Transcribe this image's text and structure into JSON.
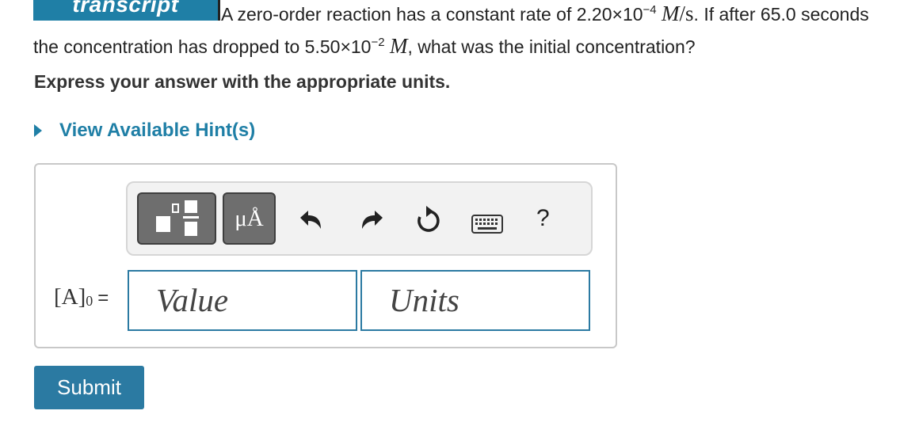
{
  "header": {
    "logo_text": "transcript"
  },
  "question": {
    "text_1": "A zero-order reaction has a constant rate of 2.20×10",
    "exp_1": "−4",
    "unit_1": "M",
    "unit_1b": "/s",
    "text_2": ". If after 65.0 seconds the concentration has dropped to 5.50×10",
    "exp_2": "−2",
    "unit_2": "M",
    "text_3": ", what was the initial concentration?"
  },
  "instructions": "Express your answer with the appropriate units.",
  "hint": {
    "label": "View Available Hint(s)"
  },
  "toolbar": {
    "units_button_label": "μÅ",
    "help_label": "?",
    "icons": [
      "templates-icon",
      "units-icon",
      "undo-icon",
      "redo-icon",
      "reset-icon",
      "keyboard-icon",
      "help-icon"
    ]
  },
  "answer": {
    "variable": "[A]",
    "subscript": "0",
    "equals": "=",
    "value_placeholder": "Value",
    "units_placeholder": "Units"
  },
  "submit_label": "Submit",
  "colors": {
    "accent": "#2b7aa2",
    "hint": "#1f7fa6",
    "toolbar_button": "#6e6e6e"
  }
}
